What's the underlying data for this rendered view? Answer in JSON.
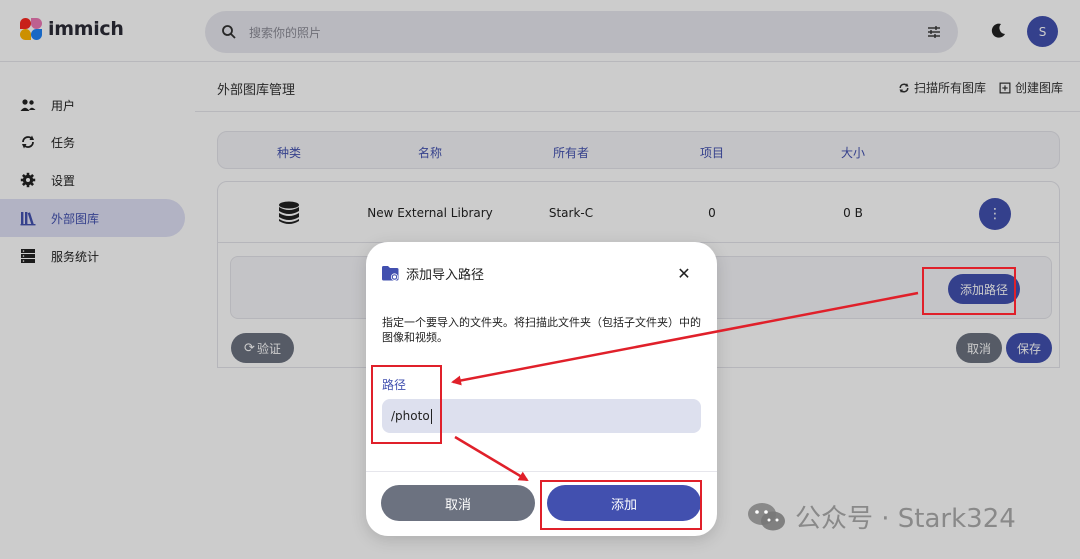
{
  "app": {
    "logo_text": "immich"
  },
  "search": {
    "placeholder": "搜索你的照片"
  },
  "user": {
    "avatar_initial": "S"
  },
  "sidebar": {
    "items": [
      {
        "label": "用户",
        "icon": "users-icon",
        "active": false
      },
      {
        "label": "任务",
        "icon": "sync-icon",
        "active": false
      },
      {
        "label": "设置",
        "icon": "gear-icon",
        "active": false
      },
      {
        "label": "外部图库",
        "icon": "library-icon",
        "active": true
      },
      {
        "label": "服务统计",
        "icon": "server-icon",
        "active": false
      }
    ]
  },
  "page": {
    "title": "外部图库管理",
    "actions": {
      "scan_all": "扫描所有图库",
      "create": "创建图库"
    }
  },
  "table": {
    "headers": [
      "种类",
      "名称",
      "所有者",
      "项目",
      "大小"
    ],
    "rows": [
      {
        "name": "New External Library",
        "owner": "Stark-C",
        "items": "0",
        "size": "0 B"
      }
    ]
  },
  "panel": {
    "add_path_label": "添加路径",
    "verify_label": "验证",
    "cancel_label": "取消",
    "save_label": "保存"
  },
  "dialog": {
    "title": "添加导入路径",
    "description": "指定一个要导入的文件夹。将扫描此文件夹（包括子文件夹）中的图像和视频。",
    "path_label": "路径",
    "path_value": "/photo",
    "cancel_label": "取消",
    "add_label": "添加"
  },
  "watermark": {
    "text": "公众号 · Stark324"
  },
  "colors": {
    "accent": "#4250af",
    "secondary": "#6c7280",
    "annotation": "#e0202a"
  }
}
